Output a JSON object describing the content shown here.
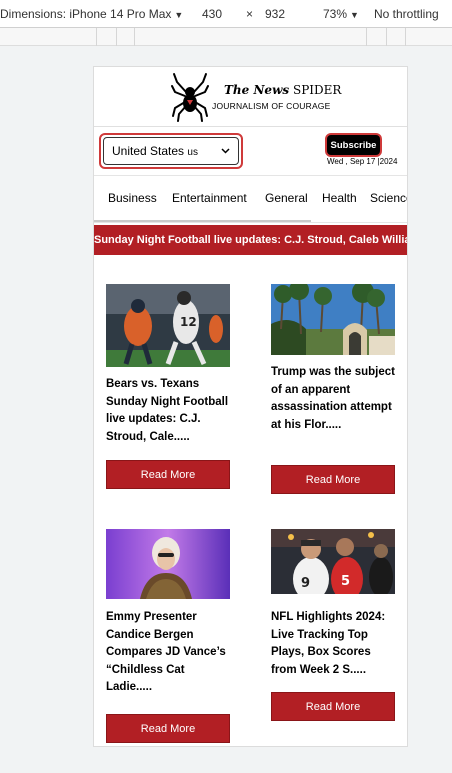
{
  "devtools": {
    "dimensions_label": "Dimensions: iPhone 14 Pro Max",
    "width": "430",
    "times": "×",
    "height": "932",
    "zoom": "73%",
    "throttling": "No throttling"
  },
  "header": {
    "title_italic": "The News",
    "title_rest": "SPIDER",
    "tagline": "JOURNALISM OF COURAGE"
  },
  "controls": {
    "country": "United States",
    "country_code": "us",
    "subscribe": "Subscribe",
    "date": "Wed , Sep 17 |2024"
  },
  "categories": [
    "Business",
    "Entertainment",
    "General",
    "Health",
    "Science"
  ],
  "ticker": "Sunday Night Football live updates: C.J. Stroud, Caleb Williams",
  "articles": [
    {
      "title": "Bears vs. Texans Sunday Night Football live updates: C.J. Stroud, Cale.....",
      "button": "Read More"
    },
    {
      "title": "Trump was the subject of an apparent assassination attempt at his Flor.....",
      "button": "Read More"
    },
    {
      "title": "Emmy Presenter Candice Bergen Compares JD Vance’s “Childless Cat Ladie.....",
      "button": "Read More"
    },
    {
      "title": "NFL Highlights 2024: Live Tracking Top Plays, Box Scores from Week 2 S.....",
      "button": "Read More"
    }
  ],
  "colors": {
    "accent": "#b21f24",
    "subscribe_border": "#cf3a3a"
  }
}
